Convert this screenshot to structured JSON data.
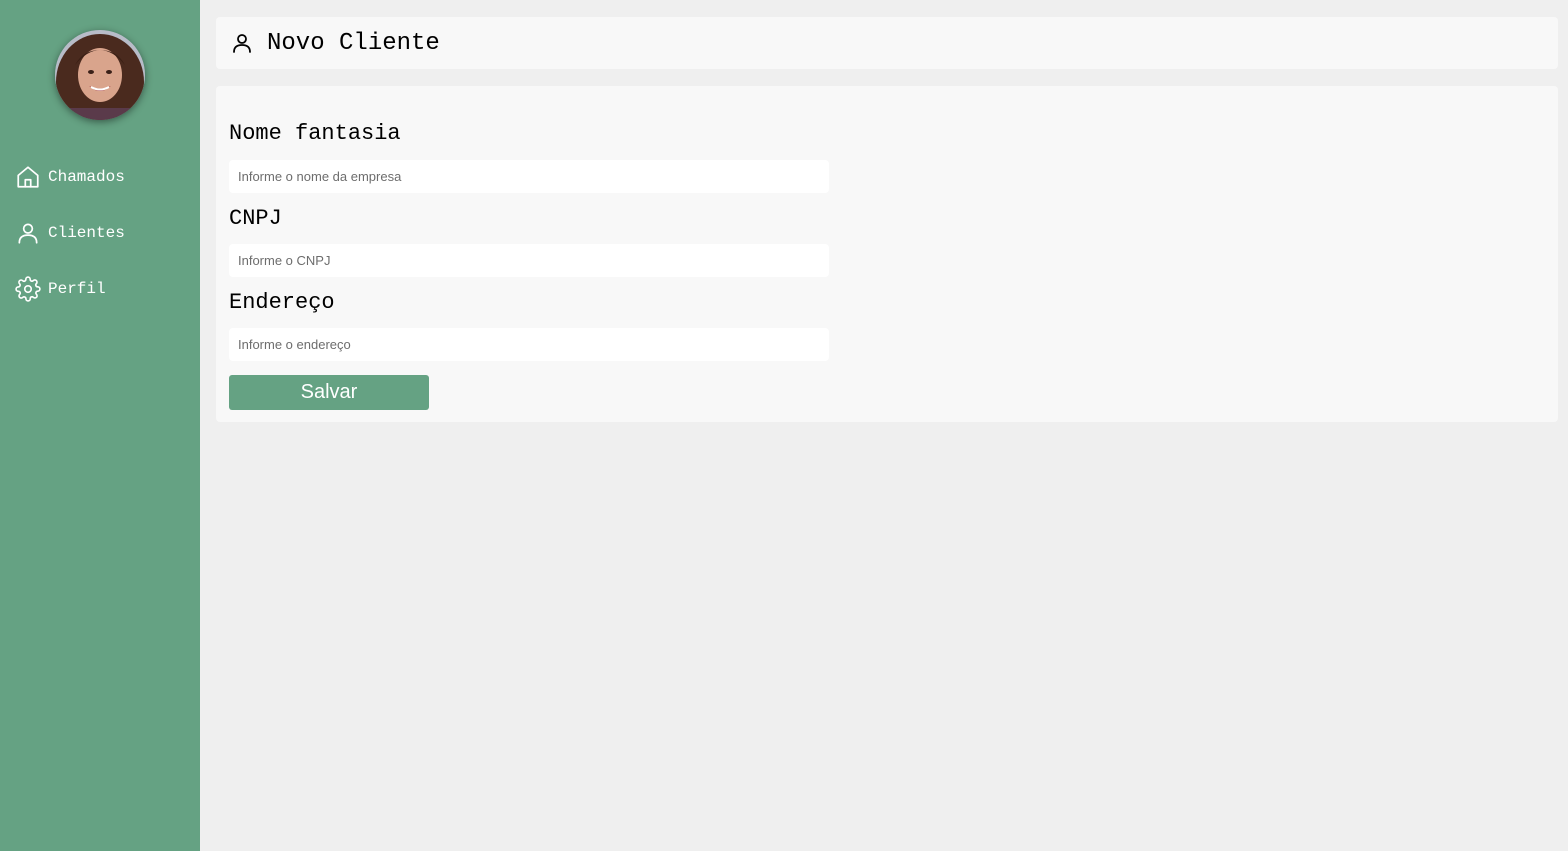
{
  "sidebar": {
    "avatar_alt": "Foto de perfil",
    "items": [
      {
        "label": "Chamados",
        "icon": "home-icon"
      },
      {
        "label": "Clientes",
        "icon": "user-icon"
      },
      {
        "label": "Perfil",
        "icon": "gear-icon"
      }
    ]
  },
  "header": {
    "icon": "user-icon",
    "title": "Novo Cliente"
  },
  "form": {
    "fields": [
      {
        "label": "Nome fantasia",
        "placeholder": "Informe o nome da empresa",
        "value": ""
      },
      {
        "label": "CNPJ",
        "placeholder": "Informe o CNPJ",
        "value": ""
      },
      {
        "label": "Endereço",
        "placeholder": "Informe o endereço",
        "value": ""
      }
    ],
    "submit_label": "Salvar"
  },
  "colors": {
    "accent": "#65a283",
    "background": "#efefef",
    "panel": "#f8f8f8"
  }
}
